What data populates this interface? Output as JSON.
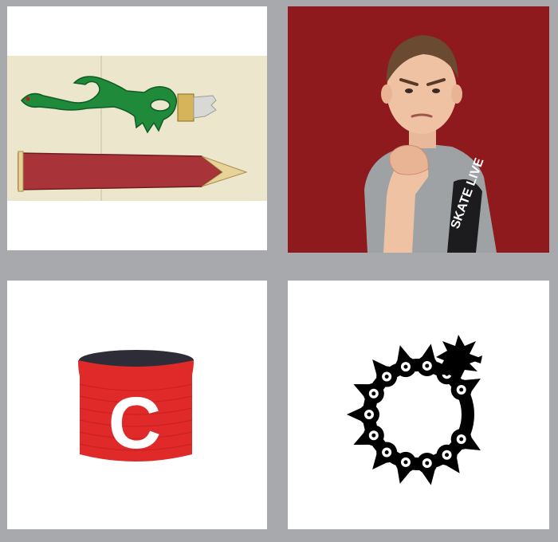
{
  "puzzle": {
    "tiles": [
      {
        "id": 1,
        "subject": "green-dragon-handle-sword-icon"
      },
      {
        "id": 2,
        "subject": "boy-with-fist-photo"
      },
      {
        "id": 3,
        "subject": "red-captain-armband-icon"
      },
      {
        "id": 4,
        "subject": "ouroboros-dragon-symbol-icon"
      }
    ]
  },
  "tile3": {
    "armband_letter": "C"
  },
  "tile2": {
    "shirt_text": "SKATE LIVE"
  },
  "colors": {
    "frame": "#a8a9ad",
    "sword_green": "#1f8a3a",
    "sword_blade": "#a8343a",
    "photo_background": "#8e1a1e",
    "armband_red": "#e02a2a"
  }
}
